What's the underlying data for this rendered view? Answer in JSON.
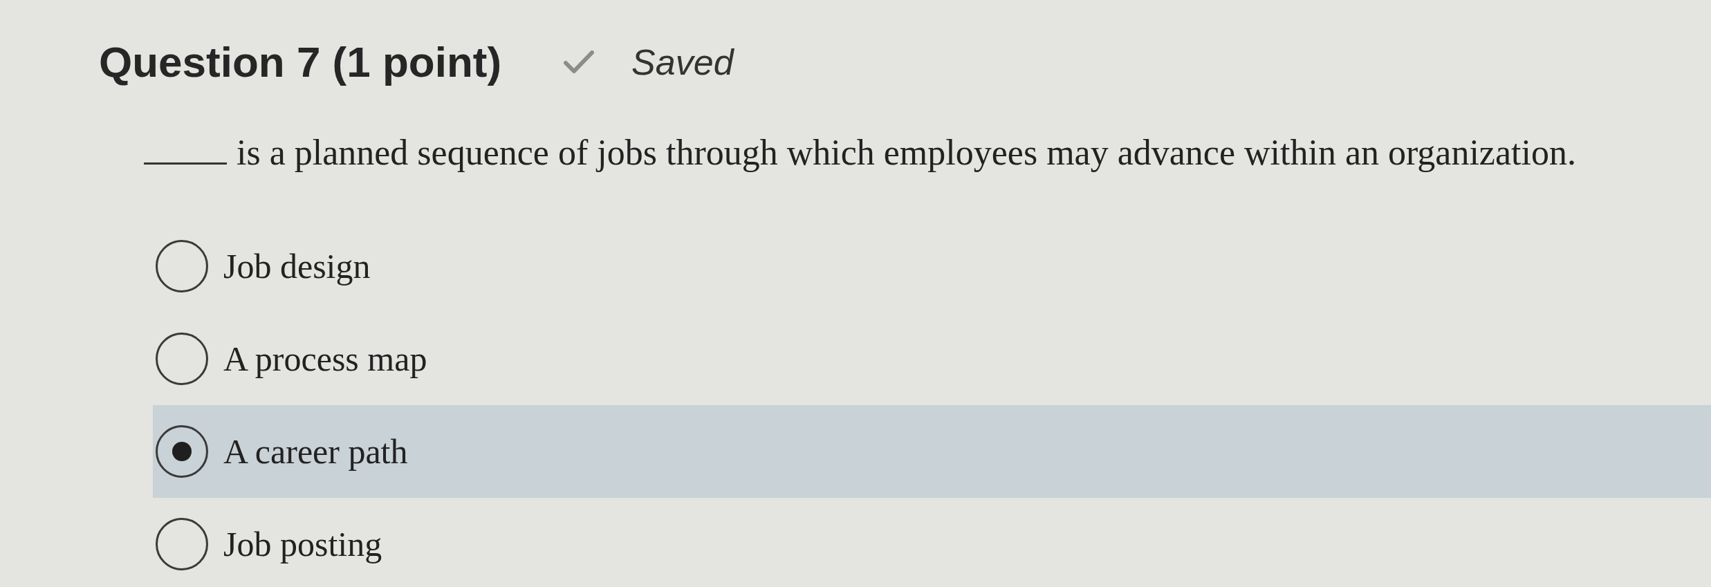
{
  "header": {
    "title": "Question 7 (1 point)",
    "status": {
      "saved": true,
      "label": "Saved"
    }
  },
  "question": {
    "blank_before": true,
    "text": "is a planned sequence of jobs through which employees may advance within an organization."
  },
  "options": [
    {
      "label": "Job design",
      "selected": false
    },
    {
      "label": "A process map",
      "selected": false
    },
    {
      "label": "A career path",
      "selected": true
    },
    {
      "label": "Job posting",
      "selected": false
    }
  ]
}
